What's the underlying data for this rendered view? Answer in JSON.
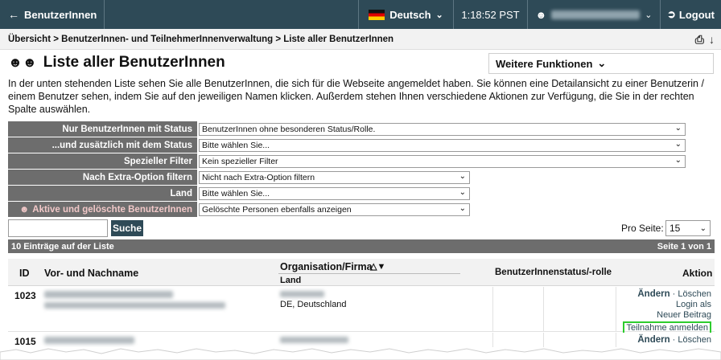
{
  "topbar": {
    "back_label": "BenutzerInnen",
    "language": "Deutsch",
    "time": "1:18:52 PST",
    "logout": "Logout"
  },
  "breadcrumb": "Übersicht > BenutzerInnen- und TeilnehmerInnenverwaltung > Liste aller BenutzerInnen",
  "page": {
    "title": "Liste aller BenutzerInnen",
    "more_functions": "Weitere Funktionen",
    "intro": "In der unten stehenden Liste sehen Sie alle BenutzerInnen, die sich für die Webseite angemeldet haben. Sie können eine Detailansicht zu einer Benutzerin / einem Benutzer sehen, indem Sie auf den jeweiligen Namen klicken. Außerdem stehen Ihnen verschiedene Aktionen zur Verfügung, die Sie in der rechten Spalte auswählen."
  },
  "filters": [
    {
      "label": "Nur BenutzerInnen mit Status",
      "value": "BenutzerInnen ohne besonderen Status/Rolle."
    },
    {
      "label": "...und zusätzlich mit dem Status",
      "value": "Bitte wählen Sie..."
    },
    {
      "label": "Spezieller Filter",
      "value": "Kein spezieller Filter"
    },
    {
      "label": "Nach Extra-Option filtern",
      "value": "Nicht nach Extra-Option filtern"
    },
    {
      "label": "Land",
      "value": "Bitte wählen Sie..."
    },
    {
      "label": "Aktive und gelöschte BenutzerInnen",
      "value": "Gelöschte Personen ebenfalls anzeigen"
    }
  ],
  "search": {
    "button": "Suche",
    "value": ""
  },
  "pagination": {
    "per_page_label": "Pro Seite:",
    "per_page_value": "15",
    "count": "10 Einträge auf der Liste",
    "page": "Seite 1 von 1"
  },
  "table": {
    "headers": {
      "id": "ID",
      "name": "Vor- und Nachname",
      "org": "Organisation/Firma",
      "land": "Land",
      "status": "BenutzerInnenstatus/-rolle",
      "action": "Aktion"
    },
    "rows": [
      {
        "id": "1023",
        "land": "DE, Deutschland",
        "actions": {
          "edit": "Ändern",
          "delete": "Löschen",
          "login": "Login als",
          "new_post": "Neuer Beitrag",
          "register": "Teilnahme anmelden"
        }
      },
      {
        "id": "1015",
        "actions": {
          "edit": "Ändern",
          "delete": "Löschen"
        }
      }
    ]
  }
}
